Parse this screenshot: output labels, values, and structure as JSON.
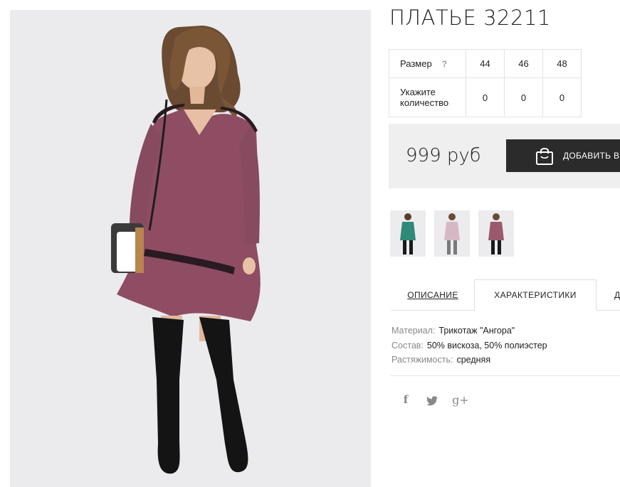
{
  "product": {
    "title": "ПЛАТЬЕ 32211",
    "price": "999 руб",
    "add_to_cart_label": "ДОБАВИТЬ В",
    "main_image_alt": "model in a mauve knit dress with black over-knee boots and a handbag"
  },
  "size_table": {
    "size_label": "Размер",
    "help_label": "?",
    "quantity_label": "Укажите количество",
    "sizes": [
      "44",
      "46",
      "48"
    ],
    "quantities": [
      "0",
      "0",
      "0"
    ]
  },
  "thumbnails": [
    {
      "color": "teal",
      "dress_hex": "#2f8a78"
    },
    {
      "color": "pink",
      "dress_hex": "#d6b8c4"
    },
    {
      "color": "mauve",
      "dress_hex": "#9a5a6c"
    }
  ],
  "tabs": {
    "description": "ОПИСАНИЕ",
    "characteristics": "ХАРАКТЕРИСТИКИ",
    "more": "Д"
  },
  "specs": [
    {
      "key": "Материал:",
      "value": "Трикотаж \"Ангора\""
    },
    {
      "key": "Состав:",
      "value": "50% вискоза, 50% полиэстер"
    },
    {
      "key": "Растяжимость:",
      "value": "средняя"
    }
  ],
  "social": {
    "facebook": "f",
    "google": "g+"
  },
  "colors": {
    "button_bg": "#2b2b2b",
    "price_box_bg": "#efefef",
    "dress": "#8e4d62",
    "photo_bg": "#ebebee"
  }
}
